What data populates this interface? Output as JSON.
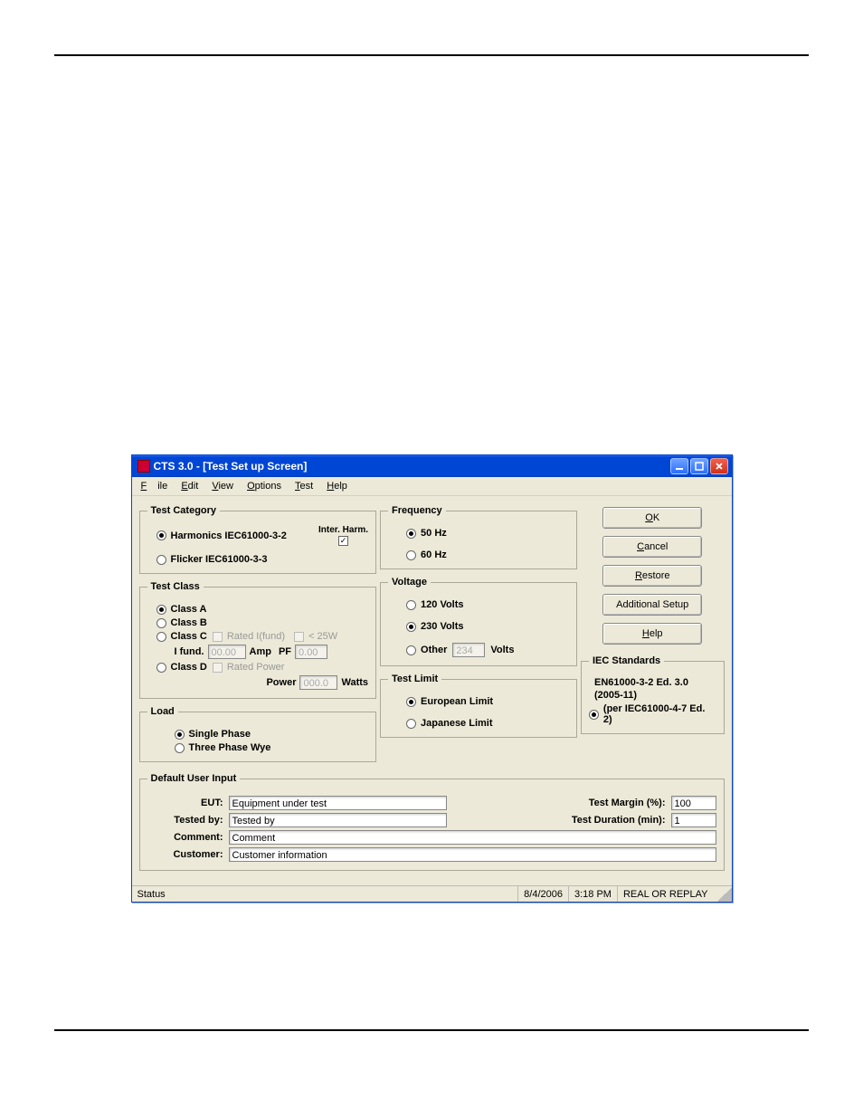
{
  "window": {
    "title": "CTS 3.0 - [Test Set up Screen]",
    "menus": {
      "file": "File",
      "edit": "Edit",
      "view": "View",
      "options": "Options",
      "test": "Test",
      "help": "Help"
    }
  },
  "groups": {
    "test_category": {
      "legend": "Test Category",
      "harmonics": "Harmonics IEC61000-3-2",
      "inter_harm_label": "Inter. Harm.",
      "flicker": "Flicker IEC61000-3-3"
    },
    "test_class": {
      "legend": "Test Class",
      "class_a": "Class A",
      "class_b": "Class B",
      "class_c": "Class C",
      "rated_i": "Rated I(fund)",
      "lt25w": "< 25W",
      "ifund_label": "I fund.",
      "ifund_val": "00.00",
      "amp": "Amp",
      "pf": "PF",
      "pf_val": "0.00",
      "class_d": "Class D",
      "rated_power": "Rated Power",
      "power_label": "Power",
      "power_val": "000.0",
      "watts": "Watts"
    },
    "load": {
      "legend": "Load",
      "single": "Single Phase",
      "wye": "Three Phase Wye"
    },
    "frequency": {
      "legend": "Frequency",
      "f50": "50 Hz",
      "f60": "60 Hz"
    },
    "voltage": {
      "legend": "Voltage",
      "v120": "120 Volts",
      "v230": "230 Volts",
      "other": "Other",
      "other_val": "234",
      "volts": "Volts"
    },
    "test_limit": {
      "legend": "Test Limit",
      "euro": "European Limit",
      "jp": "Japanese Limit"
    },
    "iec": {
      "legend": "IEC Standards",
      "line1": "EN61000-3-2 Ed. 3.0",
      "line2": "(2005-11)",
      "radio": "(per IEC61000-4-7 Ed. 2)"
    },
    "defaults": {
      "legend": "Default User Input",
      "eut_label": "EUT:",
      "eut_val": "Equipment under test",
      "tested_by_label": "Tested by:",
      "tested_by_val": "Tested by",
      "comment_label": "Comment:",
      "comment_val": "Comment",
      "customer_label": "Customer:",
      "customer_val": "Customer information",
      "margin_label": "Test Margin (%):",
      "margin_val": "100",
      "duration_label": "Test Duration (min):",
      "duration_val": "1"
    }
  },
  "buttons": {
    "ok": "OK",
    "cancel": "Cancel",
    "restore": "Restore",
    "additional": "Additional Setup",
    "help": "Help"
  },
  "statusbar": {
    "status": "Status",
    "date": "8/4/2006",
    "time": "3:18 PM",
    "mode": "REAL OR REPLAY"
  }
}
